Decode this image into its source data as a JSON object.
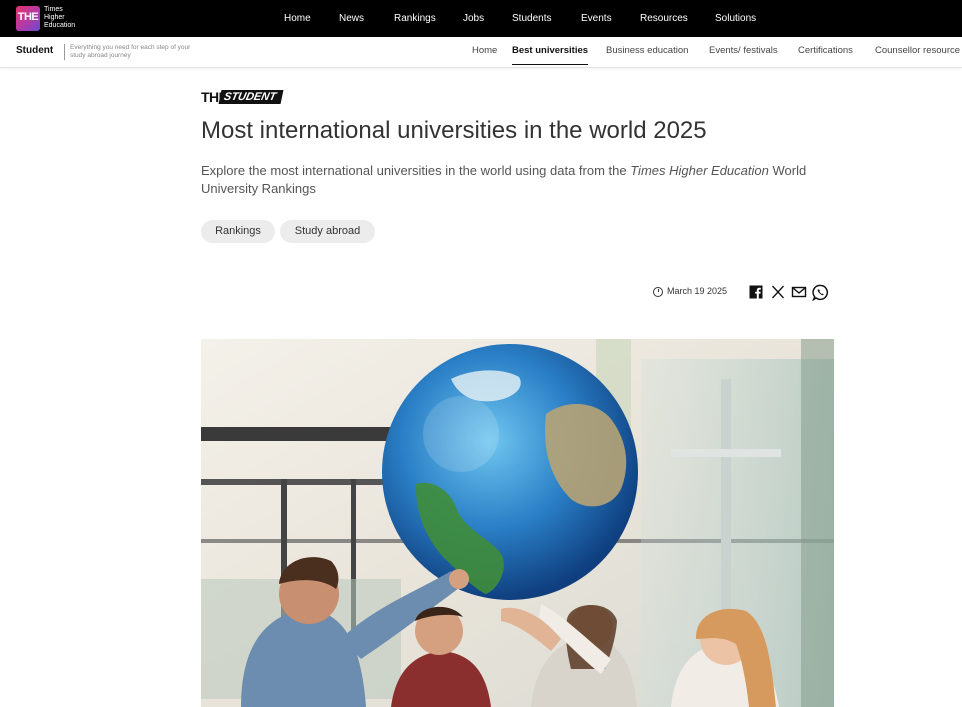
{
  "header": {
    "logo_mark": "THE",
    "logo_lines": [
      "Times",
      "Higher",
      "Education"
    ],
    "nav": [
      "Home",
      "News",
      "Rankings",
      "Jobs",
      "Students",
      "Events",
      "Resources",
      "Solutions"
    ]
  },
  "subheader": {
    "section": "Student",
    "tagline": "Everything you need for each step of your study abroad journey",
    "nav": [
      "Home",
      "Best universities",
      "Business education",
      "Events/ festivals",
      "Certifications",
      "Counsellor resource"
    ],
    "active": "Best universities"
  },
  "article": {
    "brand_the": "THE",
    "brand_student": "STUDENT",
    "title": "Most international universities in the world 2025",
    "desc_part1": "Explore the most international universities in the world using data from the ",
    "desc_italic": "Times Higher Education",
    "desc_part2": " World University Rankings",
    "tags": [
      "Rankings",
      "Study abroad"
    ],
    "date": "March 19 2025",
    "share_icons": [
      "facebook-icon",
      "x-icon",
      "mail-icon",
      "whatsapp-icon"
    ]
  }
}
